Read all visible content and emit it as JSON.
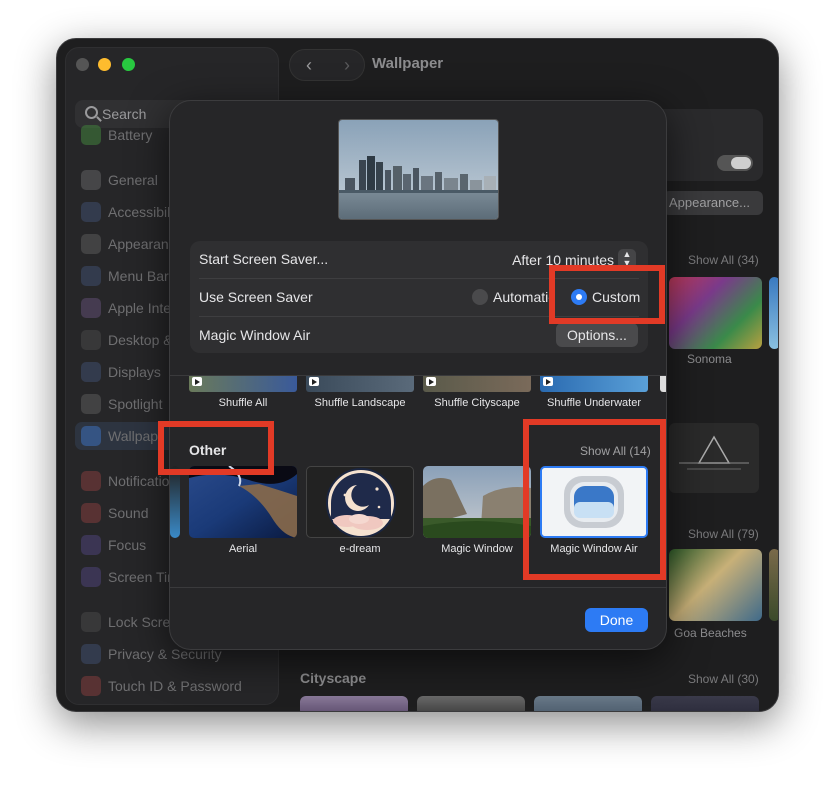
{
  "window": {
    "title": "Wallpaper",
    "traffic_lights": {
      "close_color": "#ff5f57",
      "minimize_color": "#febc2e",
      "zoom_color": "#28c840"
    }
  },
  "sidebar": {
    "search_placeholder": "Search",
    "items": [
      {
        "label": "Battery",
        "icon": "battery-icon"
      },
      {
        "label": "General",
        "icon": "gear-icon"
      },
      {
        "label": "Accessibili",
        "icon": "accessibility-icon"
      },
      {
        "label": "Appearanc",
        "icon": "appearance-icon"
      },
      {
        "label": "Menu Bar",
        "icon": "menu-bar-icon"
      },
      {
        "label": "Apple Inte",
        "icon": "apple-intelligence-icon"
      },
      {
        "label": "Desktop &",
        "icon": "desktop-dock-icon"
      },
      {
        "label": "Displays",
        "icon": "display-icon"
      },
      {
        "label": "Spotlight",
        "icon": "spotlight-icon"
      },
      {
        "label": "Wallpap",
        "icon": "wallpaper-icon",
        "selected": true
      },
      {
        "label": "Notificatio",
        "icon": "bell-icon"
      },
      {
        "label": "Sound",
        "icon": "speaker-icon"
      },
      {
        "label": "Focus",
        "icon": "moon-icon"
      },
      {
        "label": "Screen Tim",
        "icon": "hourglass-icon"
      },
      {
        "label": "Lock Scree",
        "icon": "lock-icon"
      },
      {
        "label": "Privacy & Security",
        "icon": "hand-icon"
      },
      {
        "label": "Touch ID & Password",
        "icon": "fingerprint-icon"
      }
    ]
  },
  "background": {
    "appearance_button": "Appearance...",
    "show_all_34": "Show All (34)",
    "sonoma_label": "Sonoma",
    "show_all_79": "Show All (79)",
    "goa_label": "Goa Beaches",
    "cityscape_title": "Cityscape",
    "show_all_30": "Show All (30)"
  },
  "modal": {
    "settings": {
      "start_label": "Start Screen Saver...",
      "start_value": "After 10 minutes",
      "use_label": "Use Screen Saver",
      "radio_automatic": "Automatic",
      "radio_custom": "Custom",
      "magic_label": "Magic Window Air",
      "options_button": "Options..."
    },
    "shuffle_strip": [
      {
        "label": "Shuffle All"
      },
      {
        "label": "Shuffle Landscape"
      },
      {
        "label": "Shuffle Cityscape"
      },
      {
        "label": "Shuffle Underwater"
      }
    ],
    "other": {
      "title": "Other",
      "show_all": "Show All (14)",
      "tiles": [
        {
          "label": "Aerial"
        },
        {
          "label": "e-dream"
        },
        {
          "label": "Magic Window"
        },
        {
          "label": "Magic Window Air",
          "selected": true
        }
      ]
    },
    "done_button": "Done"
  },
  "colors": {
    "accent": "#2d7bf4",
    "highlight": "#e23a26"
  }
}
